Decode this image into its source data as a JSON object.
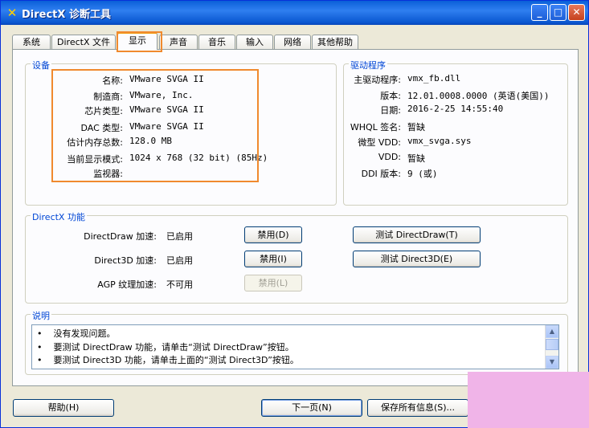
{
  "window": {
    "title": "DirectX 诊断工具",
    "minimize": "_",
    "maximize": "□",
    "close": "✕"
  },
  "tabs": [
    "系统",
    "DirectX 文件",
    "显示",
    "声音",
    "音乐",
    "输入",
    "网络",
    "其他帮助"
  ],
  "active_tab": "显示",
  "device": {
    "group_label": "设备",
    "rows": [
      {
        "label": "名称:",
        "value": "VMware SVGA II"
      },
      {
        "label": "制造商:",
        "value": "VMware, Inc."
      },
      {
        "label": "芯片类型:",
        "value": "VMware SVGA II"
      },
      {
        "label": "DAC 类型:",
        "value": "VMware SVGA II"
      },
      {
        "label": "估计内存总数:",
        "value": "128.0 MB"
      },
      {
        "label": "当前显示模式:",
        "value": "1024 x 768 (32 bit) (85Hz)"
      },
      {
        "label": "监视器:",
        "value": ""
      }
    ]
  },
  "driver": {
    "group_label": "驱动程序",
    "rows": [
      {
        "label": "主驱动程序:",
        "value": "vmx_fb.dll"
      },
      {
        "label": "版本:",
        "value": "12.01.0008.0000 (英语(美国))"
      },
      {
        "label": "日期:",
        "value": "2016-2-25 14:55:40"
      },
      {
        "label": "WHQL 签名:",
        "value": "暂缺"
      },
      {
        "label": "微型 VDD:",
        "value": "vmx_svga.sys"
      },
      {
        "label": "VDD:",
        "value": "暂缺"
      },
      {
        "label": "DDI 版本:",
        "value": "9 (或)"
      }
    ]
  },
  "features": {
    "group_label": "DirectX 功能",
    "rows": [
      {
        "label": "DirectDraw 加速:",
        "value": "已启用",
        "disable_button": "禁用(D)",
        "test_button": "测试 DirectDraw(T)"
      },
      {
        "label": "Direct3D 加速:",
        "value": "已启用",
        "disable_button": "禁用(I)",
        "test_button": "测试 Direct3D(E)"
      },
      {
        "label": "AGP 纹理加速:",
        "value": "不可用",
        "disable_button": "禁用(L)"
      }
    ]
  },
  "notes": {
    "group_label": "说明",
    "items": [
      "没有发现问题。",
      "要测试 DirectDraw 功能，请单击“测试 DirectDraw”按钮。",
      "要测试 Direct3D 功能，请单击上面的“测试 Direct3D”按钮。"
    ],
    "bullet": "•"
  },
  "bottom": {
    "help": "帮助(H)",
    "next": "下一页(N)",
    "save": "保存所有信息(S)..."
  }
}
